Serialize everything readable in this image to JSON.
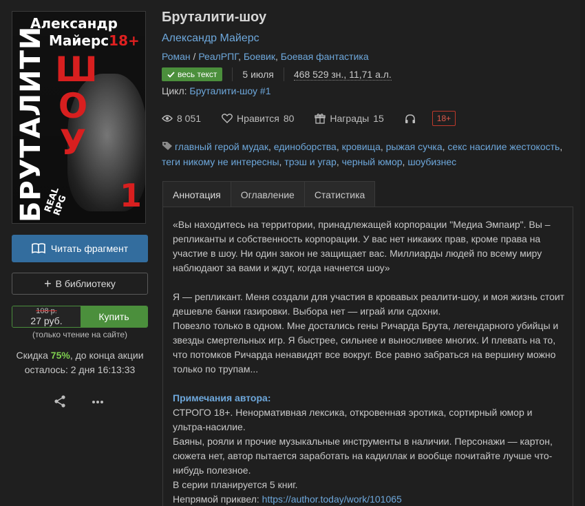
{
  "cover": {
    "author_line1": "Александр",
    "author_line2": "Майерс",
    "age": "18+",
    "title_vertical": "БРУТАЛИТИ",
    "show_letters": [
      "Ш",
      "О",
      "У"
    ],
    "number": "1",
    "real": "REAL",
    "rpg": "RPG"
  },
  "actions": {
    "read_label": "Читать фрагмент",
    "library_label": "В библиотеку",
    "old_price": "108 р.",
    "new_price": "27 руб.",
    "buy_label": "Купить",
    "price_note": "(только чтение на сайте)",
    "discount_prefix": "Скидка ",
    "discount_pct": "75%",
    "discount_suffix": ", до конца акции",
    "discount_remaining": "осталось: 2 дня 16:13:33"
  },
  "book": {
    "title": "Бруталити-шоу",
    "author": "Александр Майерс",
    "genre_main": "Роман",
    "genre_sep": " / ",
    "genres": [
      "РеалРПГ",
      "Боевик",
      "Боевая фантастика"
    ],
    "full_text_badge": "весь текст",
    "date": "5 июля",
    "size": "468 529 зн., 11,71 а.л.",
    "cycle_label": "Цикл: ",
    "cycle_value": "Бруталити-шоу #1"
  },
  "stats": {
    "views": "8 051",
    "likes_label": "Нравится",
    "likes": "80",
    "awards_label": "Награды",
    "awards": "15",
    "age": "18+"
  },
  "tags": [
    "главный герой мудак",
    "единоборства",
    "кровища",
    "рыжая сучка",
    "секс насилие жестокость",
    "теги никому не интересны",
    "трэш и угар",
    "черный юмор",
    "шоубизнес"
  ],
  "tabs": [
    "Аннотация",
    "Оглавление",
    "Статистика"
  ],
  "annotation": {
    "p1": "«Вы находитесь на территории, принадлежащей корпорации \"Медиа Эмпаир\". Вы – репликанты и собственность корпорации. У вас нет никаких прав, кроме права на участие в шоу. Ни один закон не защищает вас. Миллиарды людей по всему миру наблюдают за вами и ждут, когда начнется шоу»",
    "p2": "Я — репликант. Меня создали для участия в кровавых реалити-шоу, и моя жизнь стоит дешевле банки газировки. Выбора нет — играй или сдохни.",
    "p3": "Повезло только в одном. Мне достались гены Ричарда Брута, легендарного убийцы и звезды смертельных игр. Я быстрее, сильнее и выносливее многих. И плевать на то, что потомков Ричарда ненавидят все вокруг. Все равно забраться на вершину можно только по трупам...",
    "notes_heading": "Примечания автора:",
    "n1": "СТРОГО 18+. Ненормативная лексика, откровенная эротика, сортирный юмор и ультра-насилие.",
    "n2": "Баяны, рояли и прочие музыкальные инструменты в наличии. Персонажи — картон, сюжета нет, автор пытается заработать на кадиллак и вообще почитайте лучше что-нибудь полезное.",
    "n3": "В серии планируется 5 книг.",
    "n4_label": "Непрямой приквел: ",
    "n4_link": "https://author.today/work/101065"
  }
}
